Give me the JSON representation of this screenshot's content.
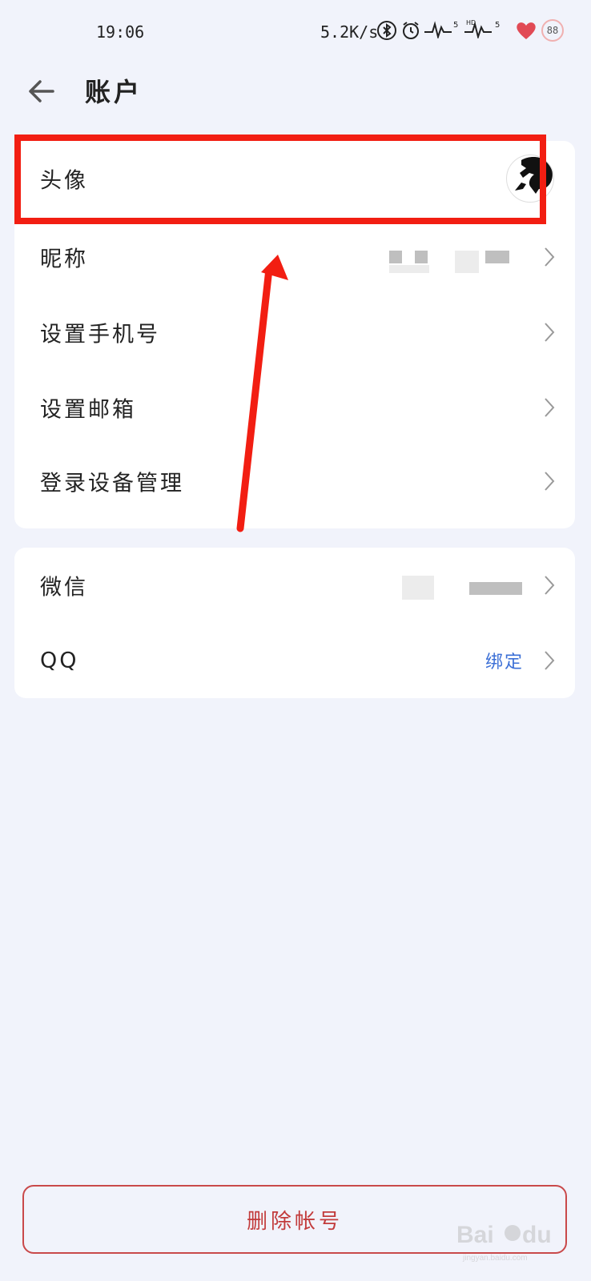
{
  "status_bar": {
    "time": "19:06",
    "net_speed": "5.2K/s",
    "battery": "88",
    "icons": [
      "bluetooth-icon",
      "alarm-icon",
      "signal-5-icon",
      "hd-signal-5-icon",
      "heart-icon",
      "battery-icon"
    ]
  },
  "header": {
    "title": "账户",
    "back_icon": "arrow-left-icon"
  },
  "account_card": {
    "rows": [
      {
        "label": "头像",
        "value_type": "avatar"
      },
      {
        "label": "昵称",
        "value_type": "blurred"
      },
      {
        "label": "设置手机号",
        "value_type": "none"
      },
      {
        "label": "设置邮箱",
        "value_type": "none"
      },
      {
        "label": "登录设备管理",
        "value_type": "none"
      }
    ]
  },
  "binding_card": {
    "rows": [
      {
        "label": "微信",
        "value_type": "blurred"
      },
      {
        "label": "QQ",
        "value": "绑定"
      }
    ]
  },
  "delete_button": {
    "label": "删除帐号"
  },
  "colors": {
    "background": "#f1f3fb",
    "card": "#ffffff",
    "link": "#3b6fd6",
    "danger": "#c23b3b",
    "annotation": "#f21e12"
  },
  "watermark": {
    "text": "Bai du 经验",
    "sub": "jingyan.baidu.com"
  }
}
